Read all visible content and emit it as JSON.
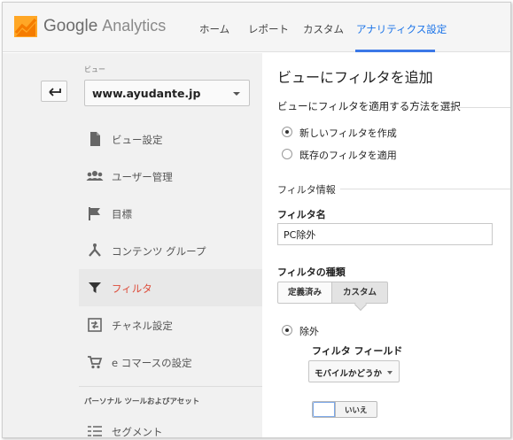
{
  "header": {
    "brand_google": "Google",
    "brand_product": "Analytics",
    "nav": [
      {
        "label": "ホーム",
        "active": false
      },
      {
        "label": "レポート",
        "active": false
      },
      {
        "label": "カスタム",
        "active": false
      },
      {
        "label": "アナリティクス設定",
        "active": true
      }
    ],
    "accent": "#3b78e7",
    "logo_colors": [
      "#f57c00",
      "#ffa726"
    ]
  },
  "sidebar": {
    "view_label": "ビュー",
    "view_selected": "www.ayudante.jp",
    "items": [
      {
        "label": "ビュー設定",
        "icon": "document-icon",
        "active": false
      },
      {
        "label": "ユーザー管理",
        "icon": "users-icon",
        "active": false
      },
      {
        "label": "目標",
        "icon": "flag-icon",
        "active": false
      },
      {
        "label": "コンテンツ グループ",
        "icon": "content-group-icon",
        "active": false
      },
      {
        "label": "フィルタ",
        "icon": "filter-icon",
        "active": true
      },
      {
        "label": "チャネル設定",
        "icon": "channel-icon",
        "active": false
      },
      {
        "label": "e コマースの設定",
        "icon": "cart-icon",
        "active": false
      }
    ],
    "section_title": "パーソナル ツールおよびアセット",
    "section_items": [
      {
        "label": "セグメント",
        "icon": "segment-icon"
      }
    ],
    "active_color": "#dd4b39"
  },
  "main": {
    "title": "ビューにフィルタを追加",
    "method_title": "ビューにフィルタを適用する方法を選択",
    "methods": [
      {
        "label": "新しいフィルタを作成",
        "selected": true
      },
      {
        "label": "既存のフィルタを適用",
        "selected": false
      }
    ],
    "info_title": "フィルタ情報",
    "name_label": "フィルタ名",
    "name_value": "PC除外",
    "type_label": "フィルタの種類",
    "type_tabs": [
      {
        "label": "定義済み",
        "selected": false
      },
      {
        "label": "カスタム",
        "selected": true
      }
    ],
    "exclude_label": "除外",
    "field_label": "フィルタ フィールド",
    "field_value": "モバイルかどうか",
    "toggle_label": "いいえ"
  }
}
